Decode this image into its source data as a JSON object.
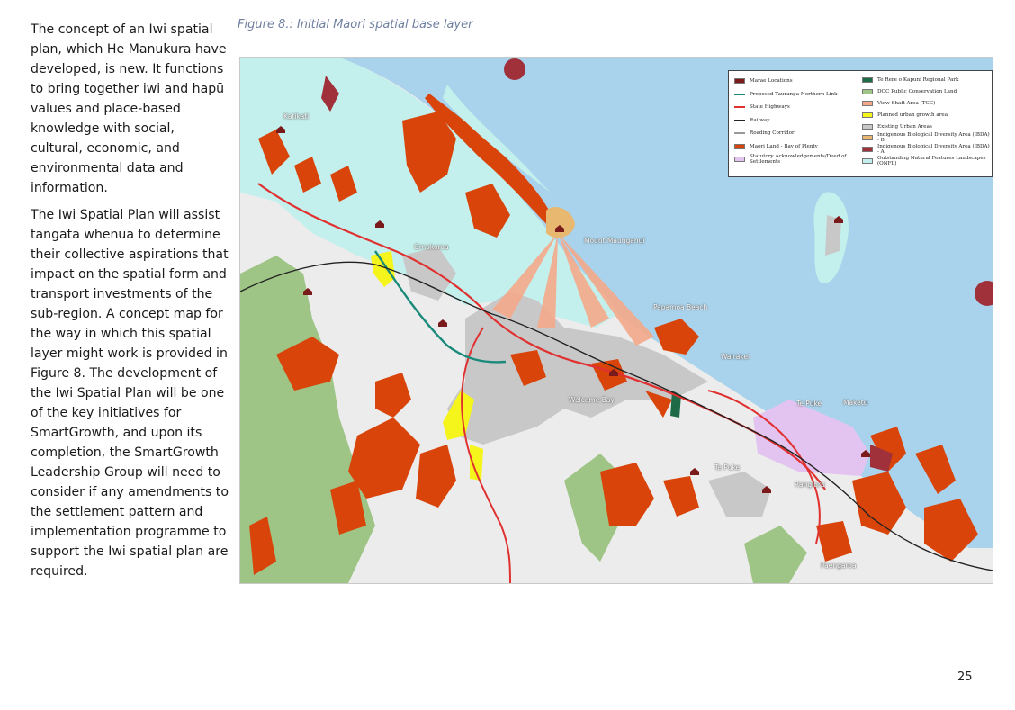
{
  "body": {
    "paragraphs": [
      "The concept of an Iwi spatial plan, which He Manukura have developed, is new. It functions to bring together iwi and hapū values and place-based knowledge with social, cultural, economic, and environmental data and information.",
      "The Iwi Spatial Plan will assist tangata whenua to determine their collective aspirations that impact on the spatial form and transport investments of the sub-region. A concept map for the way in which this spatial layer might work is provided in Figure 8. The development of the Iwi Spatial Plan will be one of the key initiatives for SmartGrowth, and upon its completion, the SmartGrowth Leadership Group will need to consider if any amendments to the settlement pattern and implementation programme to support the Iwi spatial plan are required."
    ]
  },
  "figure": {
    "caption": "Figure 8.: Initial Maori spatial base layer"
  },
  "map": {
    "labels": {
      "katikati": "Katikati",
      "omokoroa": "Omokoroa",
      "mount": "Mount Maunganui",
      "papamoa": "Papamoa Beach",
      "wairakei": "Wairakei",
      "tepuke_east": "Te Puke",
      "maketu": "Maketu",
      "tepuke": "Te Puke",
      "rangiuru": "Rangiuru",
      "paengaroa": "Paengaroa",
      "welcome": "Welcome Bay"
    },
    "legend": {
      "left": [
        {
          "label": "Marae Locations",
          "kind": "marae",
          "color": "#7a1a1a"
        },
        {
          "label": "Proposed Tauranga Northern Link",
          "kind": "line",
          "color": "#1a8a7a"
        },
        {
          "label": "State Highways",
          "kind": "line",
          "color": "#e03030"
        },
        {
          "label": "Railway",
          "kind": "line",
          "color": "#222222"
        },
        {
          "label": "Roading Corridor",
          "kind": "line",
          "color": "#999999"
        },
        {
          "label": "Maori Land - Bay of Plenty",
          "kind": "fill",
          "color": "#d9440a"
        },
        {
          "label": "Statutory Acknowledgements/Deed of Settlements",
          "kind": "fill",
          "color": "#e3c4f0"
        }
      ],
      "right": [
        {
          "label": "Te Rere o Kapuni Regional Park",
          "kind": "fill",
          "color": "#1e6b48"
        },
        {
          "label": "DOC Public Conservation Land",
          "kind": "fill",
          "color": "#9ec585"
        },
        {
          "label": "View Shaft Area (TCC)",
          "kind": "fill",
          "color": "#f4a88a"
        },
        {
          "label": "Planned urban growth area",
          "kind": "fill",
          "color": "#f5f51c"
        },
        {
          "label": "Existing Urban Areas",
          "kind": "fill",
          "color": "#c8c8c8"
        },
        {
          "label": "Indigenous Biological Diversity Area (IBDA) - B",
          "kind": "fill",
          "color": "#e8b870"
        },
        {
          "label": "Indigenous Biological Diversity Area (IBDA) - A",
          "kind": "fill",
          "color": "#a0303a"
        },
        {
          "label": "Outstanding Natural Features Landscapes (ONFL)",
          "kind": "fill",
          "color": "#c3f0ec"
        }
      ]
    },
    "colors": {
      "sea": "#a9d3ec",
      "land": "#ececec",
      "harbour": "#c3f0ec",
      "maori_land": "#d9440a",
      "urban": "#c8c8c8",
      "doc": "#9ec585",
      "growth": "#f5f51c",
      "viewshaft": "#f4a88a",
      "statutory": "#e3c4f0",
      "ibda_a": "#a0303a",
      "highway": "#e03030",
      "tnl": "#1a8a7a"
    }
  },
  "footer": {
    "page_number": "25"
  }
}
